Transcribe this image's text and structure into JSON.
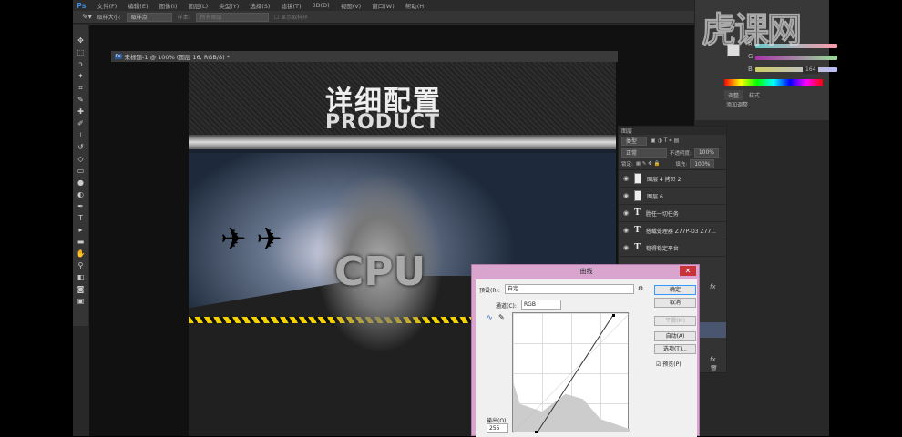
{
  "menubar": {
    "logo": "Ps",
    "items": [
      "文件(F)",
      "编辑(E)",
      "图像(I)",
      "图层(L)",
      "类型(Y)",
      "选择(S)",
      "滤镜(T)",
      "3D(D)",
      "视图(V)",
      "窗口(W)",
      "帮助(H)"
    ]
  },
  "options": {
    "sample_size_label": "取样大小:",
    "sample_size": "取样点",
    "sample_label": "样本:",
    "sample": "所有图层",
    "show_ring": "显示取样环"
  },
  "document": {
    "tab_title": "未标题-1 @ 100% (图层 16, RGB/8) *",
    "heading_cn": "详细配置",
    "heading_en": "PRODUCT",
    "cpu_text": "CPU"
  },
  "color_panel": {
    "channels": [
      "R",
      "G",
      "B"
    ],
    "b_value": "164",
    "tabs": [
      "调整",
      "样式"
    ],
    "add_adjustment": "添加调整"
  },
  "layers": {
    "title": "图层",
    "filter": "类型",
    "blend": "正常",
    "opacity_label": "不透明度:",
    "opacity": "100%",
    "lock_label": "锁定:",
    "fill_label": "填充:",
    "fill": "100%",
    "items": [
      {
        "name": "图层 4 拷贝 2",
        "type": "pixel"
      },
      {
        "name": "图层 6",
        "type": "pixel"
      },
      {
        "name": "胜任一切任务",
        "type": "text"
      },
      {
        "name": "搭载处理器 Z77P-D3 Z77...",
        "type": "text"
      },
      {
        "name": "稳得稳定平台",
        "type": "text"
      }
    ]
  },
  "curves": {
    "title": "曲线",
    "preset_label": "预设(R):",
    "preset": "自定",
    "channel_label": "通道(C):",
    "channel": "RGB",
    "output_label": "输出(O):",
    "output": "255",
    "ok": "确定",
    "cancel": "取消",
    "smooth": "平滑(M)",
    "auto": "自动(A)",
    "options": "选项(T)...",
    "preview": "预览(P)",
    "preview_checked": true
  },
  "watermark": "虎课网"
}
